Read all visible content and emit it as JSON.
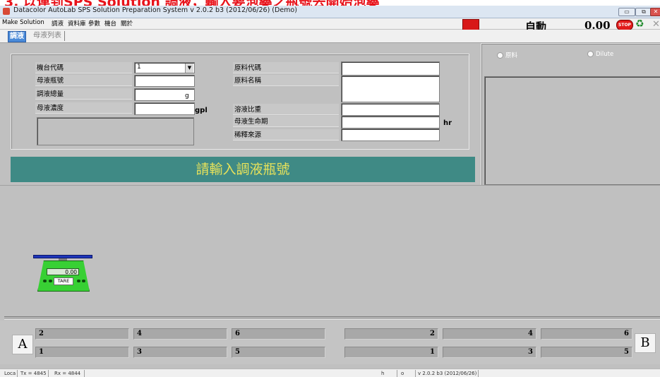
{
  "banner": {
    "text": "3. 以連到SPS Solution 調液，輸入要泡藥之瓶號去開始泡藥"
  },
  "window": {
    "title": "Datacolor AutoLab SPS Solution Preparation System  v 2.0.2 b3 (2012/06/26) (Demo)",
    "controls": [
      "▭",
      "⧉",
      "✕"
    ]
  },
  "menu": {
    "items": [
      "Make Solution",
      "調液",
      "資料庫",
      "參數",
      "機台",
      "關於"
    ]
  },
  "header": {
    "mode": "自動",
    "weight": "0.00",
    "stop_label": "STOP",
    "close_icon": "✕",
    "recycle_icon": "♻"
  },
  "tabs": [
    {
      "label": "調液"
    },
    {
      "label": "母液列表"
    }
  ],
  "form": {
    "machine_code_label": "機台代碼",
    "machine_code_value": "1",
    "stock_bottle_label": "母液瓶號",
    "stock_bottle_value": "",
    "total_weight_label": "調液總量",
    "total_weight_unit": "g",
    "concentration_label": "母液濃度",
    "concentration_unit": "gpl",
    "material_code_label": "原料代碼",
    "material_name_label": "原料名稱",
    "solvent_density_label": "溶液比重",
    "shelf_life_label": "母液生命期",
    "shelf_life_unit": "hr",
    "dilution_source_label": "稀釋來源"
  },
  "prompt": {
    "text": "請輸入調液瓶號"
  },
  "right": {
    "radio1": "原料",
    "radio2": "Dilute"
  },
  "scale": {
    "reading": "0.00",
    "tare_label": "TARE"
  },
  "stations": {
    "left_label": "A",
    "right_label": "B",
    "top_left": [
      "2",
      "4",
      "6"
    ],
    "bottom_left": [
      "1",
      "3",
      "5"
    ],
    "top_right": [
      "2",
      "4",
      "6"
    ],
    "bottom_right": [
      "1",
      "3",
      "5"
    ]
  },
  "status": {
    "loc": "Loca",
    "tx": "Tx = 4845",
    "rx": "Rx = 4844",
    "h": "h",
    "o": "o",
    "version": "v 2.0.2 b3 (2012/06/26)"
  }
}
